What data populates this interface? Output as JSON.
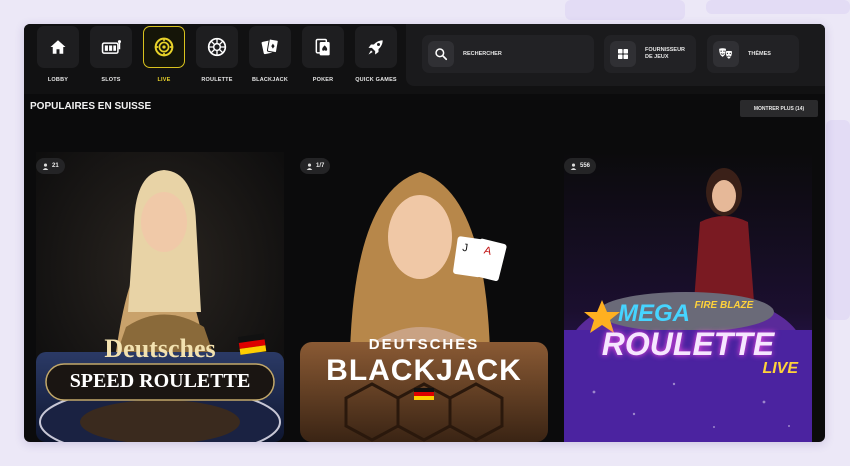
{
  "nav": {
    "items": [
      {
        "label": "LOBBY",
        "icon": "home-icon"
      },
      {
        "label": "SLOTS",
        "icon": "slot-machine-icon"
      },
      {
        "label": "LIVE",
        "icon": "live-chip-icon",
        "active": true
      },
      {
        "label": "ROULETTE",
        "icon": "roulette-wheel-icon"
      },
      {
        "label": "BLACKJACK",
        "icon": "cards-icon"
      },
      {
        "label": "POKER",
        "icon": "poker-cards-icon"
      },
      {
        "label": "QUICK GAMES",
        "icon": "rocket-icon"
      }
    ]
  },
  "search": {
    "label": "RECHERCHER",
    "icon": "search-icon"
  },
  "provider": {
    "label_line1": "FOURNISSEUR",
    "label_line2": "DE JEUX",
    "icon": "grid-icon"
  },
  "themes": {
    "label": "THÈMES",
    "icon": "theater-masks-icon"
  },
  "section": {
    "title": "POPULAIRES EN SUISSE",
    "more_label": "MONTRER PLUS (14)"
  },
  "games": [
    {
      "players": "21",
      "title_line1": "Deutsches",
      "title_line2": "SPEED ROULETTE"
    },
    {
      "players": "1/7",
      "title_line1": "DEUTSCHES",
      "title_line2": "BLACKJACK"
    },
    {
      "players": "556",
      "title_line1": "MEGA",
      "title_line1b": "FIRE BLAZE",
      "title_line2": "ROULETTE",
      "title_line3": "LIVE"
    }
  ],
  "colors": {
    "accent": "#e8d22a",
    "background": "#0b0b0c",
    "page": "#ece8f7"
  }
}
